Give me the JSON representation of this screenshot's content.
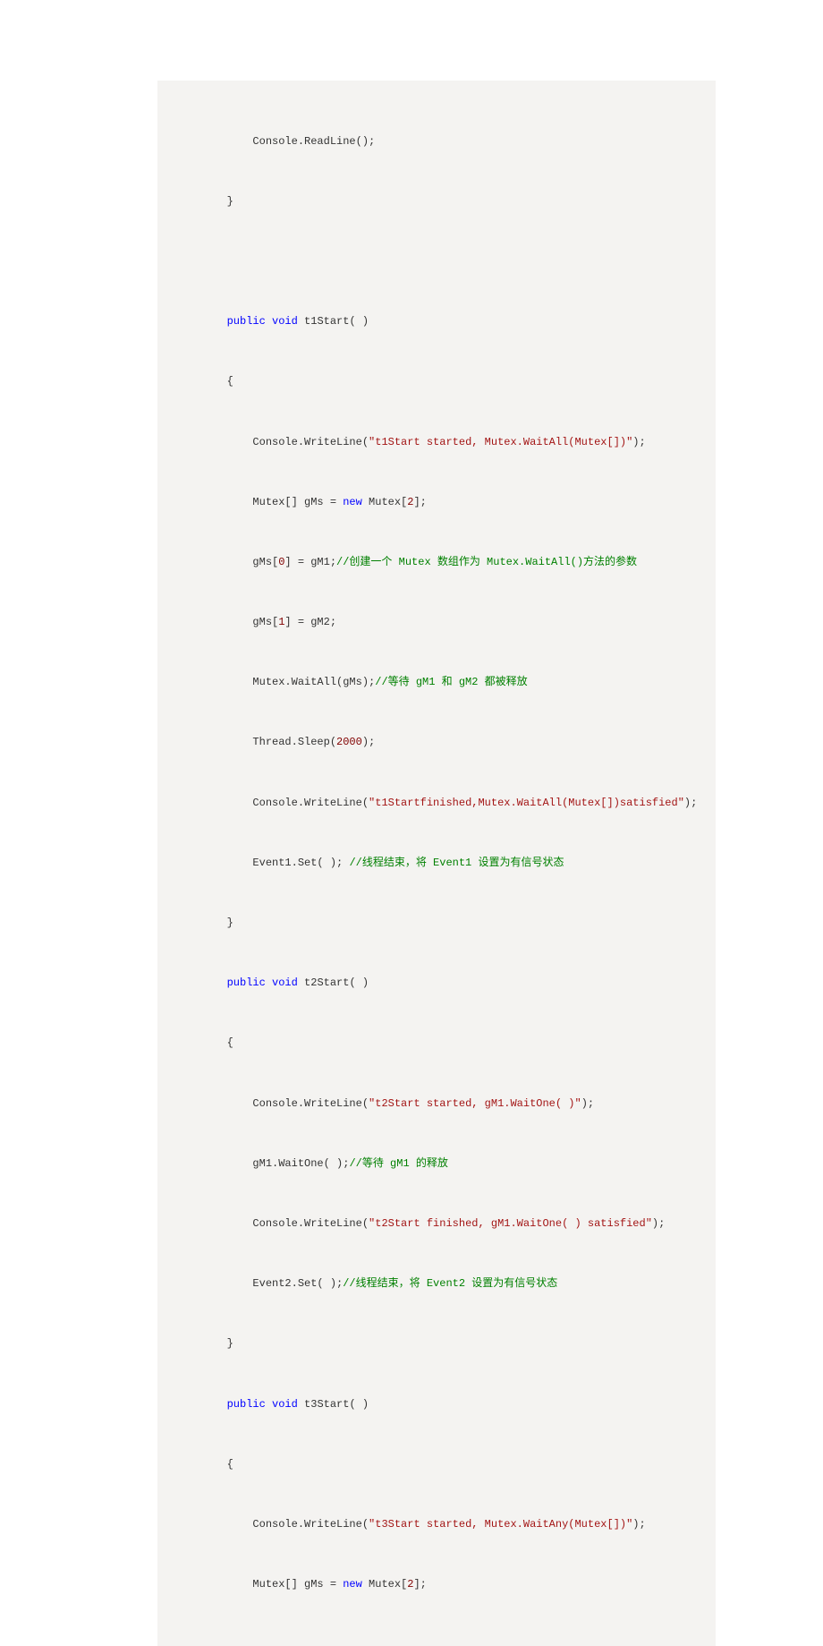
{
  "code": {
    "l1": "            Console.ReadLine();",
    "l2": "        }",
    "l3_kw1": "public",
    "l3_kw2": "void",
    "l3_rest": " t1Start( )",
    "l4": "        {",
    "l5_a": "            Console.WriteLine(",
    "l5_str": "\"t1Start started, Mutex.WaitAll(Mutex[])\"",
    "l5_b": ");",
    "l6_a": "            Mutex[] gMs = ",
    "l6_kw": "new",
    "l6_b": " Mutex[",
    "l6_num": "2",
    "l6_c": "];",
    "l7_a": "            gMs[",
    "l7_num": "0",
    "l7_b": "] = gM1;",
    "l7_cmt": "//创建一个 Mutex 数组作为 Mutex.WaitAll()方法的参数",
    "l8_a": "            gMs[",
    "l8_num": "1",
    "l8_b": "] = gM2;",
    "l9_a": "            Mutex.WaitAll(gMs);",
    "l9_cmt": "//等待 gM1 和 gM2 都被释放",
    "l10_a": "            Thread.Sleep(",
    "l10_num": "2000",
    "l10_b": ");",
    "l11_a": "            Console.WriteLine(",
    "l11_str": "\"t1Startfinished,Mutex.WaitAll(Mutex[])satisfied\"",
    "l11_b": ");",
    "l12_a": "            Event1.Set( ); ",
    "l12_cmt": "//线程结束，将 Event1 设置为有信号状态",
    "l13": "        }",
    "l14_kw1": "public",
    "l14_kw2": "void",
    "l14_rest": " t2Start( )",
    "l15": "        {",
    "l16_a": "            Console.WriteLine(",
    "l16_str": "\"t2Start started, gM1.WaitOne( )\"",
    "l16_b": ");",
    "l17_a": "            gM1.WaitOne( );",
    "l17_cmt": "//等待 gM1 的释放",
    "l18_a": "            Console.WriteLine(",
    "l18_str": "\"t2Start finished, gM1.WaitOne( ) satisfied\"",
    "l18_b": ");",
    "l19_a": "            Event2.Set( );",
    "l19_cmt": "//线程结束，将 Event2 设置为有信号状态",
    "l20": "        }",
    "l21_kw1": "public",
    "l21_kw2": "void",
    "l21_rest": " t3Start( )",
    "l22": "        {",
    "l23_a": "            Console.WriteLine(",
    "l23_str": "\"t3Start started, Mutex.WaitAny(Mutex[])\"",
    "l23_b": ");",
    "l24_a": "            Mutex[] gMs = ",
    "l24_kw": "new",
    "l24_b": " Mutex[",
    "l24_num": "2",
    "l24_c": "];"
  }
}
